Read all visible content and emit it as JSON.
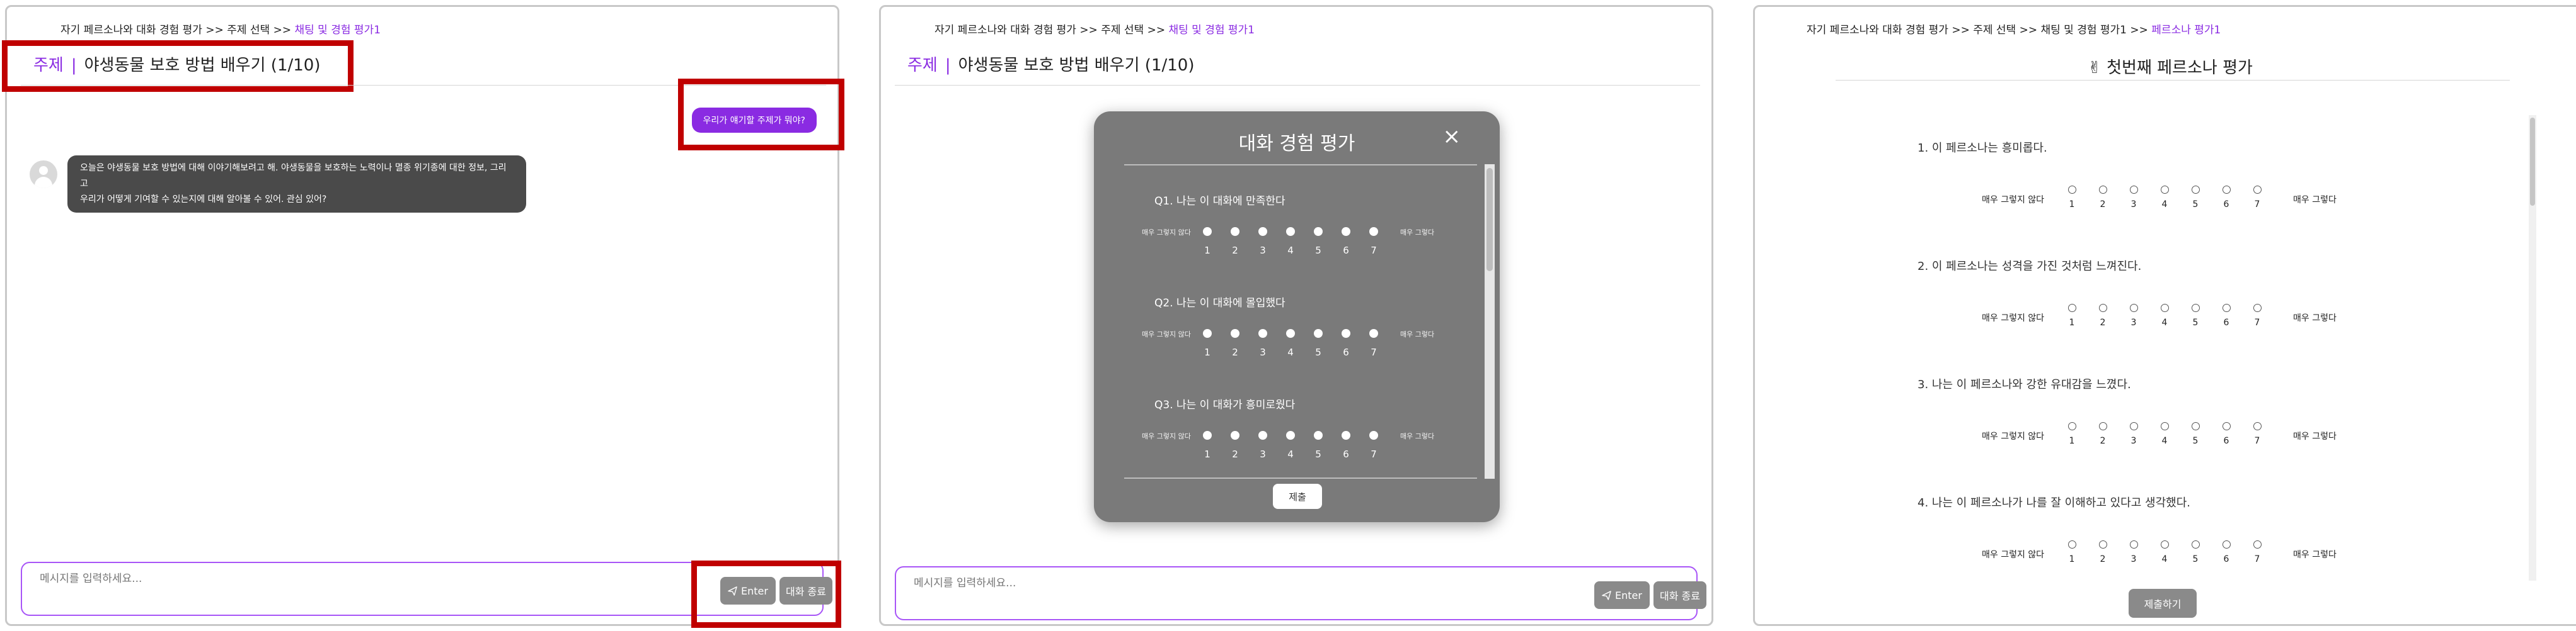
{
  "breadcrumb": {
    "base": "자기 페르소나와 대화 경험 평가 >> 주제 선택 >>",
    "chat_eval": "채팅 및 경험 평가1",
    "persona_eval_prefix": "자기 페르소나와 대화 경험 평가 >> 주제 선택 >> 채팅 및 경험 평가1 >>",
    "persona_eval": "페르소나 평가1"
  },
  "topic": {
    "keyword": "주제",
    "separator": "|",
    "title": "야생동물 보호 방법 배우기",
    "progress": "(1/10)"
  },
  "chat": {
    "user_message": "우리가 얘기할 주제가 뭐야?",
    "bot_message_line1": "오늘은 야생동물 보호 방법에 대해 이야기해보려고 해. 야생동물을 보호하는 노력이나 멸종 위기종에 대한 정보, 그리고",
    "bot_message_line2": "우리가 어떻게 기여할 수 있는지에 대해 알아볼 수 있어. 관심 있어?"
  },
  "input": {
    "placeholder": "메시지를 입력하세요...",
    "enter_label": "Enter",
    "end_label": "대화 종료"
  },
  "modal": {
    "title": "대화 경험 평가",
    "close": "×",
    "scale_low": "매우 그렇지 않다",
    "scale_high": "매우 그렇다",
    "questions": [
      "Q1. 나는 이 대화에 만족한다",
      "Q2. 나는 이 대화에 몰입했다",
      "Q3. 나는 이 대화가 흥미로웠다"
    ],
    "submit": "제출"
  },
  "persona_eval": {
    "title": "✌ 첫번째 페르소나 평가",
    "scale_low": "매우 그렇지 않다",
    "scale_high": "매우 그렇다",
    "questions": [
      "1. 이 페르소나는 흥미롭다.",
      "2. 이 페르소나는 성격을 가진 것처럼 느껴진다.",
      "3. 나는 이 페르소나와 강한 유대감을 느꼈다.",
      "4. 나는 이 페르소나가 나를 잘 이해하고 있다고 생각했다."
    ],
    "submit": "제출하기"
  },
  "scale_numbers": [
    "1",
    "2",
    "3",
    "4",
    "5",
    "6",
    "7"
  ],
  "colors": {
    "accent": "#8a2be2",
    "highlight": "#c00000",
    "button_gray": "#8a8a8a",
    "bot_bubble": "#4a4a4a",
    "modal": "#7a7a7a"
  },
  "icons": {
    "send": "send-icon",
    "avatar": "user-avatar-icon",
    "close": "close-icon"
  }
}
